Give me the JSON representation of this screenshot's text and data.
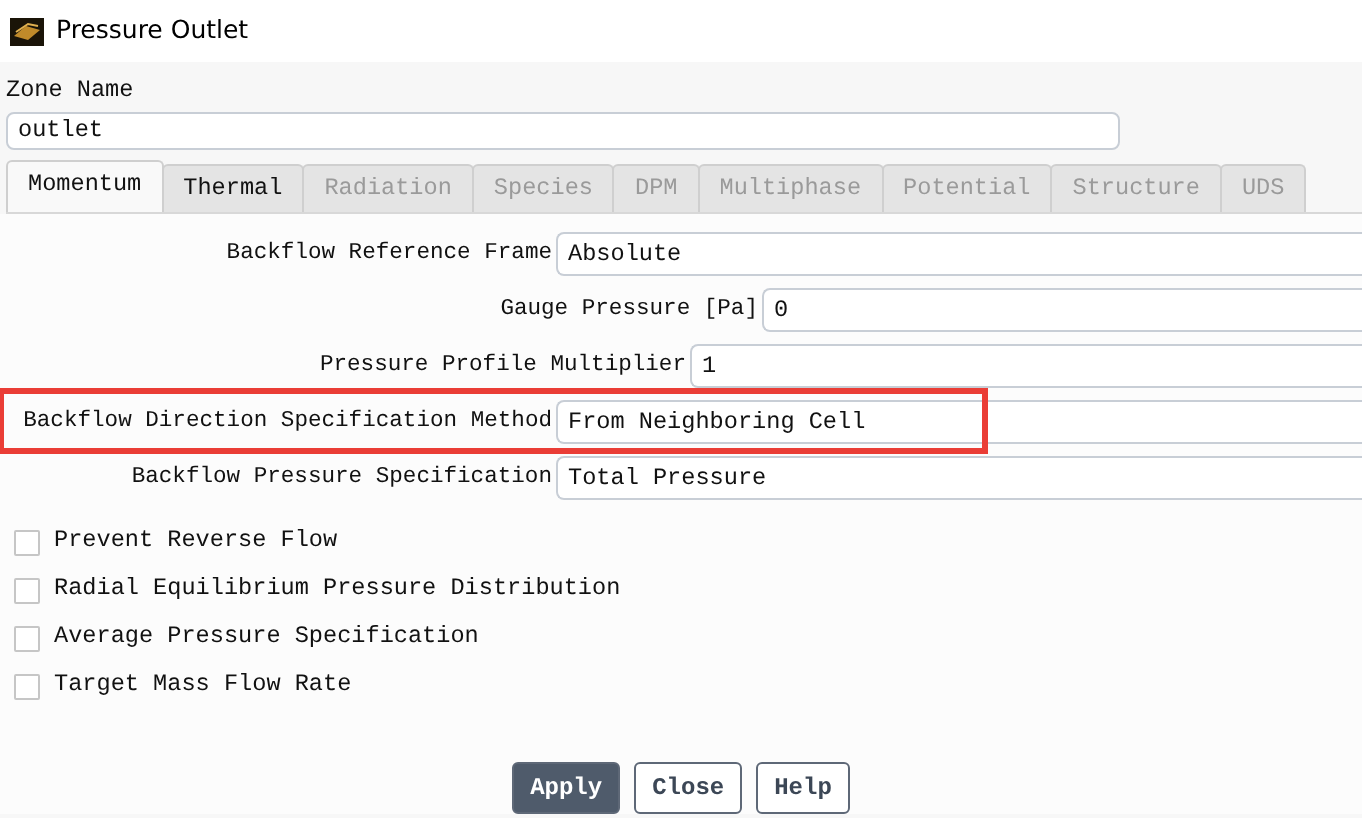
{
  "window": {
    "title": "Pressure Outlet"
  },
  "zone_name": {
    "label": "Zone Name",
    "value": "outlet"
  },
  "tabs": [
    {
      "label": "Momentum",
      "selected": true,
      "disabled": false
    },
    {
      "label": "Thermal",
      "selected": false,
      "disabled": false
    },
    {
      "label": "Radiation",
      "selected": false,
      "disabled": true
    },
    {
      "label": "Species",
      "selected": false,
      "disabled": true
    },
    {
      "label": "DPM",
      "selected": false,
      "disabled": true
    },
    {
      "label": "Multiphase",
      "selected": false,
      "disabled": true
    },
    {
      "label": "Potential",
      "selected": false,
      "disabled": true
    },
    {
      "label": "Structure",
      "selected": false,
      "disabled": true
    },
    {
      "label": "UDS",
      "selected": false,
      "disabled": true
    }
  ],
  "fields": [
    {
      "label": "Backflow Reference Frame",
      "value": "Absolute",
      "highlighted": false
    },
    {
      "label": "Gauge Pressure [Pa]",
      "value": "0",
      "highlighted": false
    },
    {
      "label": "Pressure Profile Multiplier",
      "value": "1",
      "highlighted": false
    },
    {
      "label": "Backflow Direction Specification Method",
      "value": "From Neighboring Cell",
      "highlighted": true
    },
    {
      "label": "Backflow Pressure Specification",
      "value": "Total Pressure",
      "highlighted": false
    }
  ],
  "options": [
    {
      "label": "Prevent Reverse Flow",
      "checked": false
    },
    {
      "label": "Radial Equilibrium Pressure Distribution",
      "checked": false
    },
    {
      "label": "Average Pressure Specification",
      "checked": false
    },
    {
      "label": "Target Mass Flow Rate",
      "checked": false
    }
  ],
  "buttons": [
    {
      "label": "Apply",
      "kind": "primary"
    },
    {
      "label": "Close",
      "kind": "secondary"
    },
    {
      "label": "Help",
      "kind": "secondary"
    }
  ]
}
